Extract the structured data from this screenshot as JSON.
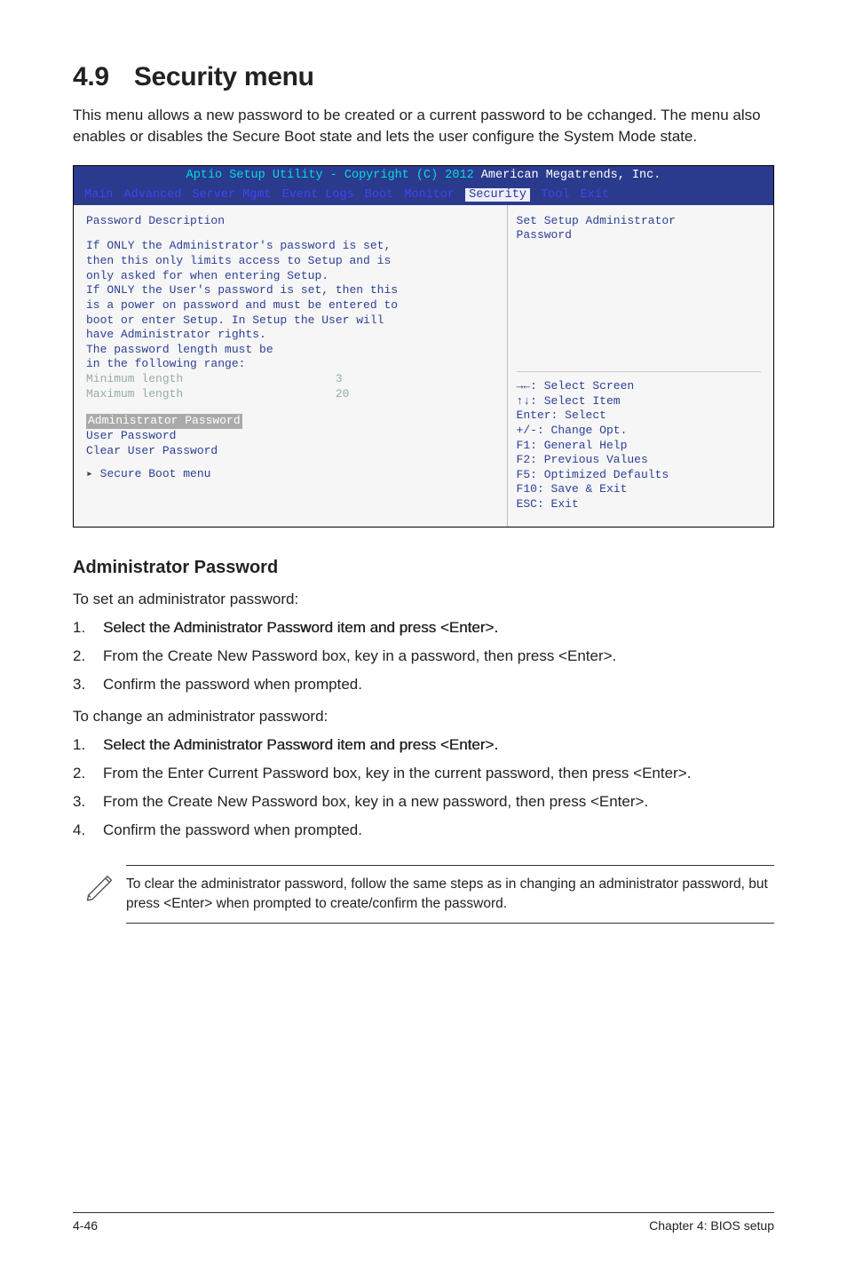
{
  "heading": {
    "number": "4.9",
    "title": "Security menu"
  },
  "lead": "This menu allows a new password to be created or a current password to be cchanged. The menu also enables or disables the Secure Boot state and lets the user configure the System Mode state.",
  "bios": {
    "title_left": "Aptio Setup Utility - Copyright (C) 2012 ",
    "title_right": "American Megatrends, Inc.",
    "menu": {
      "items": [
        "Main",
        "Advanced",
        "Server Mgmt",
        "Event Logs",
        "Boot",
        "Monitor"
      ],
      "selected": "Security",
      "after": [
        "Tool",
        "Exit"
      ]
    },
    "left": {
      "heading": "Password Description",
      "lines": [
        "If ONLY the Administrator's password is set,",
        "then this only limits access to Setup and is",
        "only asked for when entering Setup.",
        "If ONLY the User's password is set, then this",
        "is a power on password and must be entered to",
        "boot or enter Setup. In Setup the User will",
        "have Administrator rights.",
        "The password length must be",
        "in the following range:"
      ],
      "min_label": "Minimum length",
      "min_val": "3",
      "max_label": "Maximum length",
      "max_val": "20",
      "selected_item": "Administrator Password",
      "items": [
        "User Password",
        "Clear User Password"
      ],
      "submenu": "Secure Boot menu"
    },
    "right": {
      "heading": "Set Setup Administrator\nPassword",
      "help": "→←: Select Screen\n↑↓: Select Item\nEnter: Select\n+/-: Change Opt.\nF1: General Help\nF2: Previous Values\nF5: Optimized Defaults\nF10: Save & Exit\nESC: Exit"
    }
  },
  "admin_pw_heading": "Administrator Password",
  "set_intro": "To set an administrator password:",
  "set_steps": [
    "Select the Administrator Password item and press <Enter>.",
    "From the Create New Password box, key in a password, then press <Enter>.",
    "Confirm the password when prompted."
  ],
  "change_intro": "To change an administrator password:",
  "change_steps": [
    "Select the Administrator Password item and press <Enter>.",
    "From the Enter Current Password box, key in the current password, then press <Enter>.",
    "From the Create New Password box, key in a new password, then press <Enter>.",
    "Confirm the password when prompted."
  ],
  "note": "To clear the administrator password, follow the same steps as in changing an administrator password, but press <Enter> when prompted to create/confirm the password.",
  "footer": {
    "left": "4-46",
    "right": "Chapter 4: BIOS setup"
  }
}
